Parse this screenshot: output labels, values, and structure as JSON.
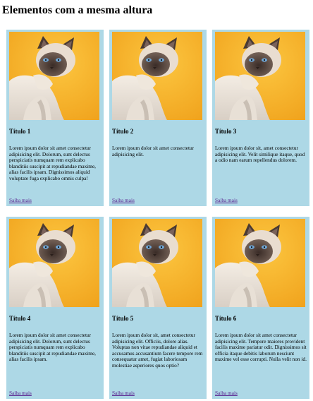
{
  "page": {
    "title": "Elementos com a mesma altura"
  },
  "cards": [
    {
      "title": "Título 1",
      "text": "Lorem ipsum dolor sit amet consectetur adipisicing elit. Dolorum, sunt delectus perspiciatis numquam rem explicabo blanditiis suscipit at repudiandae maxime, alias facilis ipsam. Dignissimos aliquid voluptate fuga explicabo omnis culpa!",
      "link": "Saiba mais"
    },
    {
      "title": "Título 2",
      "text": "Lorem ipsum dolor sit amet consectetur adipisicing elit.",
      "link": "Saiba mais"
    },
    {
      "title": "Título 3",
      "text": "Lorem ipsum dolor sit, amet consectetur adipisicing elit. Velit similique itaque, quod a odio nam earum repellendus dolorem.",
      "link": "Saiba mais"
    },
    {
      "title": "Título 4",
      "text": "Lorem ipsum dolor sit amet consectetur adipisicing elit. Dolorum, sunt delectus perspiciatis numquam rem explicabo blanditiis suscipit at repudiandae maxime, alias facilis ipsam.",
      "link": "Saiba mais"
    },
    {
      "title": "Título 5",
      "text": "Lorem ipsum dolor sit, amet consectetur adipisicing elit. Officiis, dolore alias. Voluptas non vitae repudiandae aliquid et accusamus accusantium facere tempore rem consequatur amet, fugiat laboriosam molestiae asperiores quos optio?",
      "link": "Saiba mais"
    },
    {
      "title": "Título 6",
      "text": "Lorem ipsum dolor sit amet consectetur adipisicing elit. Tempore maiores provident facilis maxime pariatur odit. Dignissimos sit officia itaque debitis laborum nesciunt maxime vel esse corrupti. Nulla velit non id.",
      "link": "Saiba mais"
    }
  ],
  "colors": {
    "card_bg": "#add8e6",
    "photo_bg": "#f7b32b",
    "link": "#551a8b"
  }
}
